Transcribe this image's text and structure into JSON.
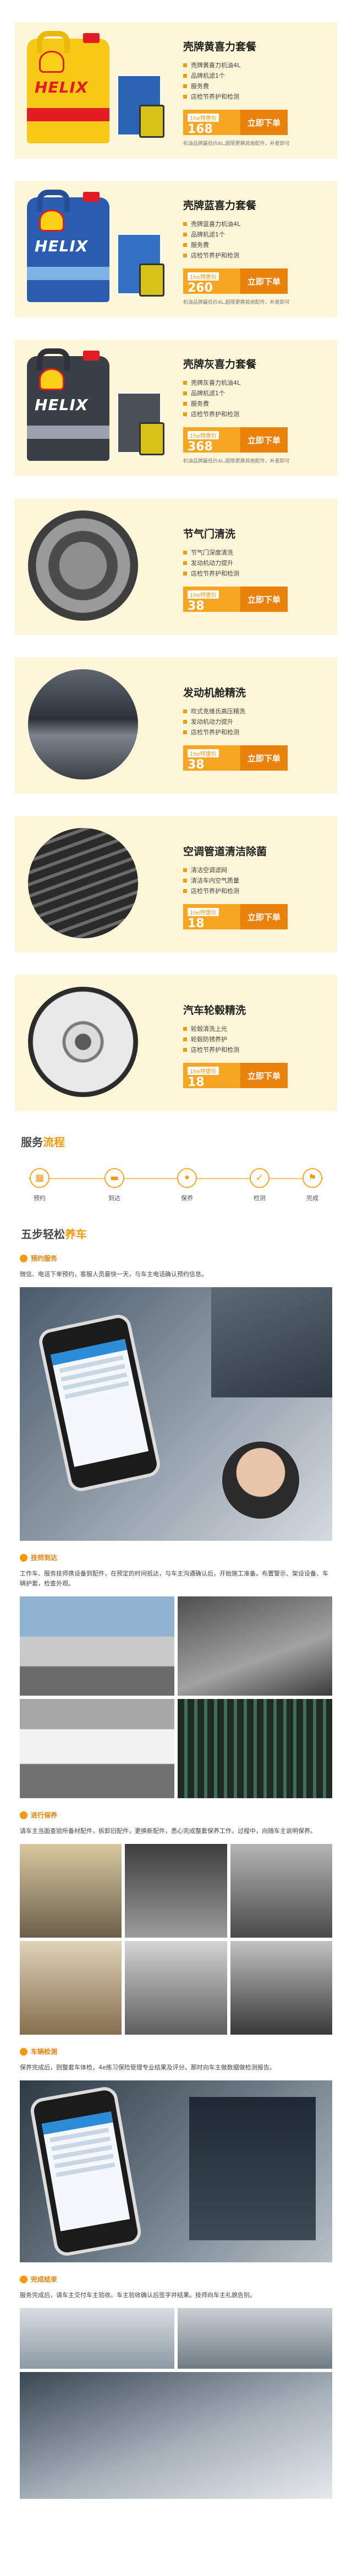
{
  "colors": {
    "accent": "#f29a0c",
    "card_bg": "#fdf6d8",
    "price_box": "#f6a623",
    "buy_button": "#e8820a"
  },
  "products": [
    {
      "title": "壳牌黄喜力套餐",
      "features": [
        "壳牌黄喜力机油4L",
        "品牌机滤1个",
        "服务费",
        "店检节养护和检测"
      ],
      "price_label": "1he特惠价",
      "price": "168",
      "buy_label": "立即下单",
      "note": "机油品牌最低价4L,超限更换其他配件，补差即可",
      "image": "shell-helix-yellow"
    },
    {
      "title": "壳牌蓝喜力套餐",
      "features": [
        "壳牌蓝喜力机油4L",
        "品牌机滤1个",
        "服务费",
        "店检节养护和检测"
      ],
      "price_label": "1he特惠价",
      "price": "260",
      "buy_label": "立即下单",
      "note": "机油品牌最低价4L,超限更换其他配件，补差即可",
      "image": "shell-helix-blue"
    },
    {
      "title": "壳牌灰喜力套餐",
      "features": [
        "壳牌灰喜力机油4L",
        "品牌机滤1个",
        "服务费",
        "店检节养护和检测"
      ],
      "price_label": "1he特惠价",
      "price": "368",
      "buy_label": "立即下单",
      "note": "机油品牌最低价4L,超限更换其他配件，补差即可",
      "image": "shell-helix-grey"
    },
    {
      "title": "节气门清洗",
      "features": [
        "节气门深度清洗",
        "发动机动力提升",
        "店检节养护和检测"
      ],
      "price_label": "1he特惠价",
      "price": "38",
      "buy_label": "立即下单",
      "note": "",
      "image": "throttle-body"
    },
    {
      "title": "发动机舱精洗",
      "features": [
        "吹式克维氏高压精洗",
        "发动机动力提升",
        "店检节养护和检测"
      ],
      "price_label": "1he特惠价",
      "price": "38",
      "buy_label": "立即下单",
      "note": "",
      "image": "engine-bay"
    },
    {
      "title": "空调管道清洁除菌",
      "features": [
        "清洁空调滤网",
        "清洁车内空气质量",
        "店检节养护和检测"
      ],
      "price_label": "1he特惠价",
      "price": "18",
      "buy_label": "立即下单",
      "note": "",
      "image": "air-vent"
    },
    {
      "title": "汽车轮毂精洗",
      "features": [
        "轮毂清洗上光",
        "轮毂防锈养护",
        "店检节养护和检测"
      ],
      "price_label": "1he特惠价",
      "price": "18",
      "buy_label": "立即下单",
      "note": "",
      "image": "wheel-rim"
    }
  ],
  "process": {
    "title_prefix": "服务",
    "title_highlight": "流程",
    "steps": [
      {
        "label": "预约",
        "icon": "calendar-icon"
      },
      {
        "label": "到达",
        "icon": "car-icon"
      },
      {
        "label": "保养",
        "icon": "wrench-icon"
      },
      {
        "label": "检测",
        "icon": "check-icon"
      },
      {
        "label": "完成",
        "icon": "flag-icon"
      }
    ]
  },
  "five_steps": {
    "title_prefix": "五步轻松",
    "title_highlight": "养车",
    "steps": [
      {
        "name": "预约服务",
        "desc": "微信、电话下单预约，客服人员最快一天，与车主电话确认预约信息。"
      },
      {
        "name": "技师到达",
        "desc": "工作车、服务技师携设备到配件，在预定的时间抵达，与车主沟通确认后，开始施工准备。布置警示、架设设备、车辆护套，检查外观。"
      },
      {
        "name": "进行保养",
        "desc": "请车主当面查验所备材配件，拆卸旧配件，更换新配件，悉心完成整套保养工作，过程中，向随车主说明保养。"
      },
      {
        "name": "车辆检测",
        "desc": "保养完成后，则整套车体检，4e练习保险管理专业结果及评分。那时向车主做数据做检测报告。"
      },
      {
        "name": "完成结束",
        "desc": "服务完成后，请车主交付车主验收。车主验收确认后签字并结果。技师向车主礼貌告别。"
      }
    ]
  }
}
